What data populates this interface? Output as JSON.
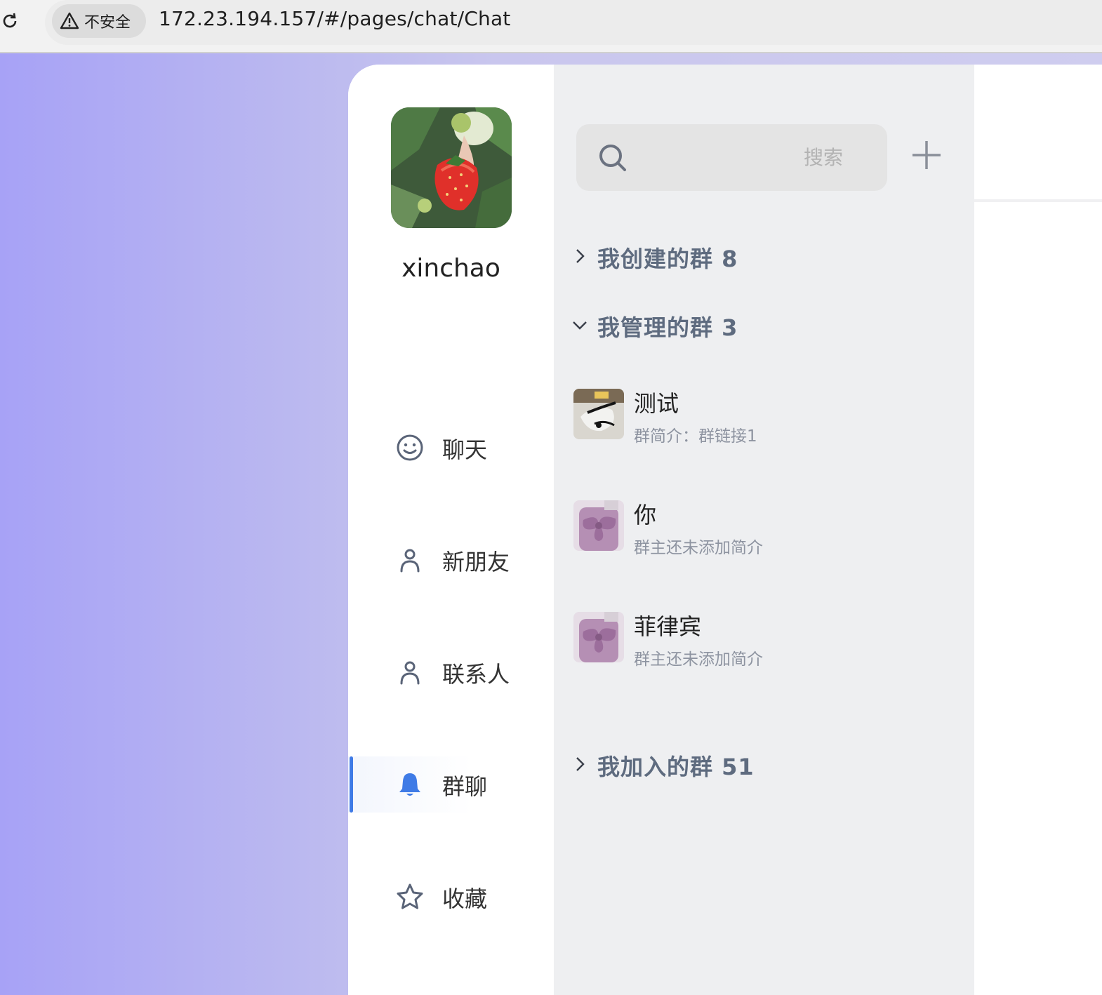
{
  "browser": {
    "security_label": "不安全",
    "url": "172.23.194.157/#/pages/chat/Chat"
  },
  "profile": {
    "username": "xinchao"
  },
  "nav": {
    "items": [
      {
        "label": "聊天",
        "icon": "smile-icon",
        "active": false
      },
      {
        "label": "新朋友",
        "icon": "user-icon",
        "active": false
      },
      {
        "label": "联系人",
        "icon": "user-icon",
        "active": false
      },
      {
        "label": "群聊",
        "icon": "bell-icon",
        "active": true
      },
      {
        "label": "收藏",
        "icon": "star-icon",
        "active": false
      }
    ]
  },
  "search": {
    "placeholder": "搜索"
  },
  "groups": {
    "sections": [
      {
        "label": "我创建的群 8",
        "expanded": false
      },
      {
        "label": "我管理的群 3",
        "expanded": true
      },
      {
        "label": "我加入的群 51",
        "expanded": false
      }
    ],
    "managed": [
      {
        "name": "测试",
        "desc": "群简介：群链接1"
      },
      {
        "name": "你",
        "desc": "群主还未添加简介"
      },
      {
        "name": "菲律宾",
        "desc": "群主还未添加简介"
      }
    ]
  },
  "colors": {
    "accent": "#3f7be6",
    "panel_bg": "#eeeff1",
    "section_text": "#5e6b7f"
  }
}
